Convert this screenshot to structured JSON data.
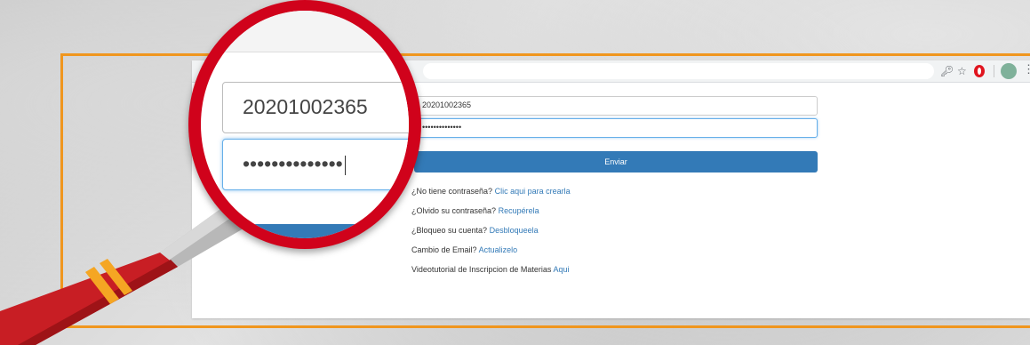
{
  "form": {
    "username_value": "20201002365",
    "password_value": "••••••••••••••",
    "submit_label": "Enviar"
  },
  "links": [
    {
      "text": "¿No tiene contraseña?",
      "link": "Clic aqui para crearla"
    },
    {
      "text": "¿Olvido su contraseña?",
      "link": "Recupérela"
    },
    {
      "text": "¿Bloqueo su cuenta?",
      "link": "Desbloqueela"
    },
    {
      "text": "Cambio de Email?",
      "link": "Actualizelo"
    },
    {
      "text": "Videotutorial de Inscripcion de Materias",
      "link": "Aqui"
    }
  ],
  "magnifier": {
    "username_value": "20201002365",
    "password_value": "••••••••••••••"
  },
  "icons": {
    "key": "key-icon",
    "star": "star-icon",
    "opera": "opera-icon",
    "avatar": "profile-avatar",
    "menu": "kebab-menu-icon"
  },
  "colors": {
    "frame": "#f0961e",
    "primary": "#337ab7",
    "magnifier_rim": "#d0021b"
  }
}
